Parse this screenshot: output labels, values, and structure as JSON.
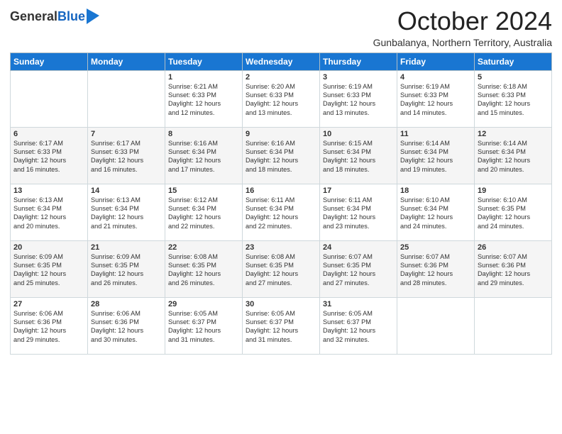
{
  "logo": {
    "general": "General",
    "blue": "Blue"
  },
  "header": {
    "month": "October 2024",
    "location": "Gunbalanya, Northern Territory, Australia"
  },
  "days": [
    "Sunday",
    "Monday",
    "Tuesday",
    "Wednesday",
    "Thursday",
    "Friday",
    "Saturday"
  ],
  "weeks": [
    [
      null,
      null,
      {
        "day": "1",
        "sunrise": "6:21 AM",
        "sunset": "6:33 PM",
        "daylight": "12 hours and 12 minutes."
      },
      {
        "day": "2",
        "sunrise": "6:20 AM",
        "sunset": "6:33 PM",
        "daylight": "12 hours and 13 minutes."
      },
      {
        "day": "3",
        "sunrise": "6:19 AM",
        "sunset": "6:33 PM",
        "daylight": "12 hours and 13 minutes."
      },
      {
        "day": "4",
        "sunrise": "6:19 AM",
        "sunset": "6:33 PM",
        "daylight": "12 hours and 14 minutes."
      },
      {
        "day": "5",
        "sunrise": "6:18 AM",
        "sunset": "6:33 PM",
        "daylight": "12 hours and 15 minutes."
      }
    ],
    [
      {
        "day": "6",
        "sunrise": "6:17 AM",
        "sunset": "6:33 PM",
        "daylight": "12 hours and 16 minutes."
      },
      {
        "day": "7",
        "sunrise": "6:17 AM",
        "sunset": "6:33 PM",
        "daylight": "12 hours and 16 minutes."
      },
      {
        "day": "8",
        "sunrise": "6:16 AM",
        "sunset": "6:34 PM",
        "daylight": "12 hours and 17 minutes."
      },
      {
        "day": "9",
        "sunrise": "6:16 AM",
        "sunset": "6:34 PM",
        "daylight": "12 hours and 18 minutes."
      },
      {
        "day": "10",
        "sunrise": "6:15 AM",
        "sunset": "6:34 PM",
        "daylight": "12 hours and 18 minutes."
      },
      {
        "day": "11",
        "sunrise": "6:14 AM",
        "sunset": "6:34 PM",
        "daylight": "12 hours and 19 minutes."
      },
      {
        "day": "12",
        "sunrise": "6:14 AM",
        "sunset": "6:34 PM",
        "daylight": "12 hours and 20 minutes."
      }
    ],
    [
      {
        "day": "13",
        "sunrise": "6:13 AM",
        "sunset": "6:34 PM",
        "daylight": "12 hours and 20 minutes."
      },
      {
        "day": "14",
        "sunrise": "6:13 AM",
        "sunset": "6:34 PM",
        "daylight": "12 hours and 21 minutes."
      },
      {
        "day": "15",
        "sunrise": "6:12 AM",
        "sunset": "6:34 PM",
        "daylight": "12 hours and 22 minutes."
      },
      {
        "day": "16",
        "sunrise": "6:11 AM",
        "sunset": "6:34 PM",
        "daylight": "12 hours and 22 minutes."
      },
      {
        "day": "17",
        "sunrise": "6:11 AM",
        "sunset": "6:34 PM",
        "daylight": "12 hours and 23 minutes."
      },
      {
        "day": "18",
        "sunrise": "6:10 AM",
        "sunset": "6:34 PM",
        "daylight": "12 hours and 24 minutes."
      },
      {
        "day": "19",
        "sunrise": "6:10 AM",
        "sunset": "6:35 PM",
        "daylight": "12 hours and 24 minutes."
      }
    ],
    [
      {
        "day": "20",
        "sunrise": "6:09 AM",
        "sunset": "6:35 PM",
        "daylight": "12 hours and 25 minutes."
      },
      {
        "day": "21",
        "sunrise": "6:09 AM",
        "sunset": "6:35 PM",
        "daylight": "12 hours and 26 minutes."
      },
      {
        "day": "22",
        "sunrise": "6:08 AM",
        "sunset": "6:35 PM",
        "daylight": "12 hours and 26 minutes."
      },
      {
        "day": "23",
        "sunrise": "6:08 AM",
        "sunset": "6:35 PM",
        "daylight": "12 hours and 27 minutes."
      },
      {
        "day": "24",
        "sunrise": "6:07 AM",
        "sunset": "6:35 PM",
        "daylight": "12 hours and 27 minutes."
      },
      {
        "day": "25",
        "sunrise": "6:07 AM",
        "sunset": "6:36 PM",
        "daylight": "12 hours and 28 minutes."
      },
      {
        "day": "26",
        "sunrise": "6:07 AM",
        "sunset": "6:36 PM",
        "daylight": "12 hours and 29 minutes."
      }
    ],
    [
      {
        "day": "27",
        "sunrise": "6:06 AM",
        "sunset": "6:36 PM",
        "daylight": "12 hours and 29 minutes."
      },
      {
        "day": "28",
        "sunrise": "6:06 AM",
        "sunset": "6:36 PM",
        "daylight": "12 hours and 30 minutes."
      },
      {
        "day": "29",
        "sunrise": "6:05 AM",
        "sunset": "6:37 PM",
        "daylight": "12 hours and 31 minutes."
      },
      {
        "day": "30",
        "sunrise": "6:05 AM",
        "sunset": "6:37 PM",
        "daylight": "12 hours and 31 minutes."
      },
      {
        "day": "31",
        "sunrise": "6:05 AM",
        "sunset": "6:37 PM",
        "daylight": "12 hours and 32 minutes."
      },
      null,
      null
    ]
  ],
  "labels": {
    "sunrise": "Sunrise:",
    "sunset": "Sunset:",
    "daylight": "Daylight:"
  }
}
